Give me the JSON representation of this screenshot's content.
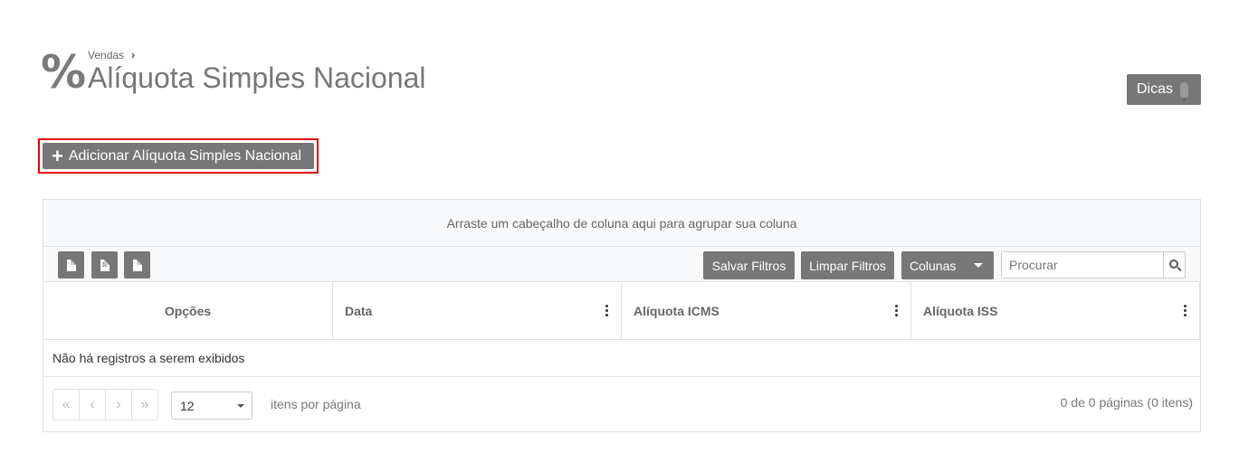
{
  "header": {
    "page_icon": "%",
    "breadcrumb_parent": "Vendas",
    "breadcrumb_separator": "›",
    "title": "Alíquota Simples Nacional",
    "tips_label": "Dicas"
  },
  "actions": {
    "add_label": "Adicionar Alíquota Simples Nacional",
    "add_icon": "+"
  },
  "grid": {
    "group_hint": "Arraste um cabeçalho de coluna aqui para agrupar sua coluna",
    "export_buttons": [
      {
        "name": "pdf-export-icon",
        "glyph": ""
      },
      {
        "name": "excel-export-icon",
        "glyph": "X"
      },
      {
        "name": "csv-export-icon",
        "glyph": ""
      }
    ],
    "save_filters_label": "Salvar Filtros",
    "clear_filters_label": "Limpar Filtros",
    "columns_label": "Colunas",
    "search_placeholder": "Procurar",
    "columns": [
      "Opções",
      "Data",
      "Alíquota ICMS",
      "Alíquota ISS"
    ],
    "empty_message": "Não há registros a serem exibidos",
    "pager": {
      "first": "«",
      "prev": "‹",
      "next": "›",
      "last": "»",
      "page_size": "12",
      "page_size_label": "itens por página",
      "info": "0 de 0 páginas (0 itens)"
    }
  }
}
